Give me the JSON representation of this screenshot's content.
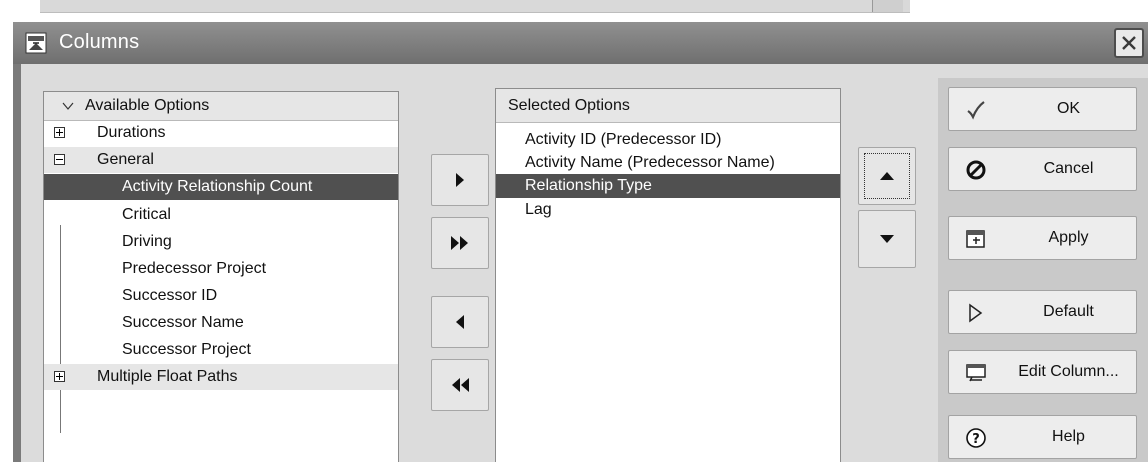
{
  "window": {
    "title": "Columns"
  },
  "available": {
    "header": "Available Options",
    "groups": [
      {
        "label": "Durations",
        "expanded": false
      },
      {
        "label": "General",
        "expanded": true,
        "items": [
          "Activity Relationship Count",
          "Critical",
          "Driving",
          "Predecessor Project",
          "Successor ID",
          "Successor Name",
          "Successor Project"
        ],
        "selected_item": "Activity Relationship Count"
      },
      {
        "label": "Multiple Float Paths",
        "expanded": false
      }
    ]
  },
  "selected": {
    "header": "Selected Options",
    "items": [
      "Activity ID  (Predecessor ID)",
      "Activity Name  (Predecessor Name)",
      "Relationship Type",
      "Lag"
    ],
    "selected_item": "Relationship Type"
  },
  "transfer_buttons": [
    {
      "name": "add-selected-button",
      "icon": "single-right-arrow-icon"
    },
    {
      "name": "add-all-button",
      "icon": "double-right-arrow-icon"
    },
    {
      "name": "remove-selected-button",
      "icon": "single-left-arrow-icon"
    },
    {
      "name": "remove-all-button",
      "icon": "double-left-arrow-icon"
    }
  ],
  "actions": [
    {
      "label": "OK",
      "icon": "checkmark-icon"
    },
    {
      "label": "Cancel",
      "icon": "cancel-icon"
    },
    {
      "label": "Apply",
      "icon": "apply-icon"
    },
    {
      "label": "Default",
      "icon": "default-icon"
    },
    {
      "label": "Edit Column...",
      "icon": "edit-column-icon"
    },
    {
      "label": "Help",
      "icon": "help-icon"
    }
  ],
  "colors": {
    "selection": "#505050",
    "titlebar": "#7a7a7a",
    "dialog_body": "#dcdcdc"
  }
}
